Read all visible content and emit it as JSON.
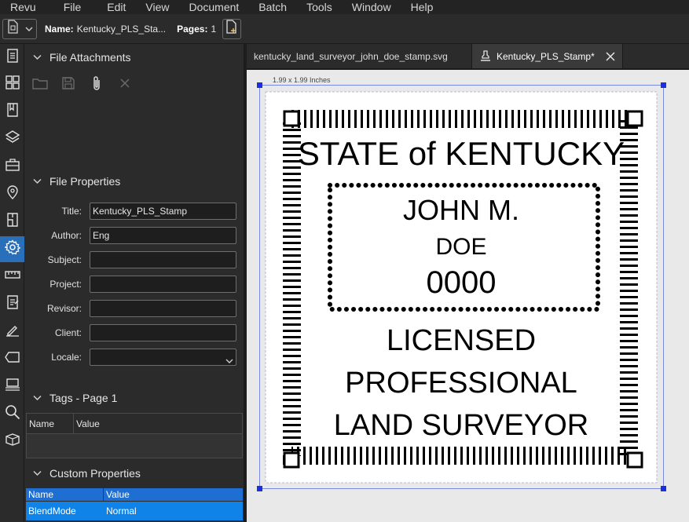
{
  "menu": [
    "Revu",
    "File",
    "Edit",
    "View",
    "Document",
    "Batch",
    "Tools",
    "Window",
    "Help"
  ],
  "toolbar": {
    "name_label": "Name:",
    "name_value": "Kentucky_PLS_Sta...",
    "pages_label": "Pages:",
    "pages_value": "1"
  },
  "rail_icons": [
    "thumbnails-icon",
    "grid-icon",
    "bookmarks-icon",
    "layers-icon",
    "toolchest-icon",
    "places-icon",
    "spaces-icon",
    "properties-icon",
    "measure-icon",
    "markups-list-icon",
    "signatures-icon",
    "tags-icon",
    "sets-icon",
    "search-icon",
    "links-icon"
  ],
  "active_rail_icon": "properties-icon",
  "panel": {
    "attachments_title": "File Attachments",
    "properties_title": "File Properties",
    "fields": [
      {
        "label": "Title:",
        "value": "Kentucky_PLS_Stamp"
      },
      {
        "label": "Author:",
        "value": "Eng"
      },
      {
        "label": "Subject:",
        "value": ""
      },
      {
        "label": "Project:",
        "value": ""
      },
      {
        "label": "Revisor:",
        "value": ""
      },
      {
        "label": "Client:",
        "value": ""
      },
      {
        "label": "Locale:",
        "value": ""
      }
    ],
    "tags_title": "Tags - Page 1",
    "tags_columns": [
      "Name",
      "Value"
    ],
    "custom_title": "Custom Properties",
    "custom_columns": [
      "Name",
      "Value"
    ],
    "custom_rows": [
      {
        "name": "BlendMode",
        "value": "Normal"
      }
    ]
  },
  "tabs": [
    {
      "label": "kentucky_land_surveyor_john_doe_stamp.svg",
      "active": false
    },
    {
      "label": "Kentucky_PLS_Stamp*",
      "active": true
    }
  ],
  "canvas": {
    "size_label": "1.99 x 1.99 Inches",
    "stamp": {
      "line1": "STATE of KENTUCKY",
      "line2": "JOHN M.",
      "line3": "DOE",
      "line4": "0000",
      "line5": "LICENSED",
      "line6": "PROFESSIONAL",
      "line7": "LAND SURVEYOR"
    }
  },
  "colors": {
    "accent": "#2a6fba",
    "selection_row": "#0f83e8",
    "handle": "#1a2fe0"
  }
}
